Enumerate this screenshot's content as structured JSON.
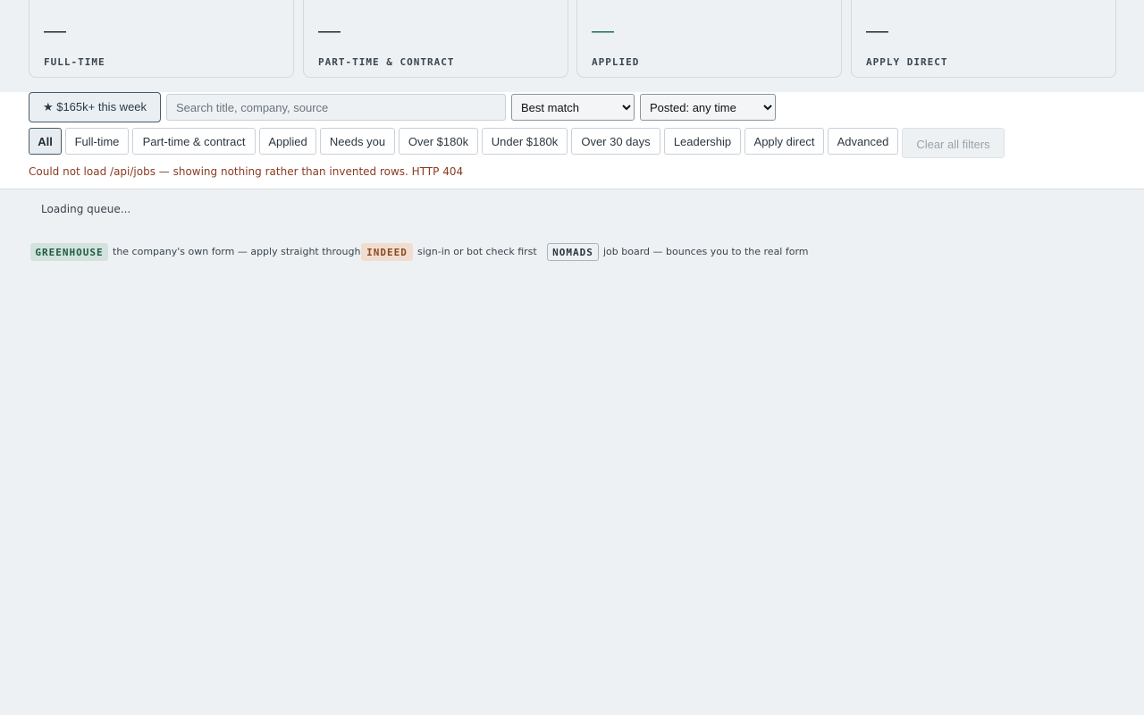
{
  "stats": [
    {
      "value": "————",
      "label": "FULL-TIME"
    },
    {
      "value": "————",
      "label": "PART-TIME & CONTRACT"
    },
    {
      "value": "————",
      "label": "APPLIED"
    },
    {
      "value": "————",
      "label": "APPLY DIRECT"
    }
  ],
  "toolbar": {
    "highlight_label": "★ $165k+ this week",
    "search_placeholder": "Search title, company, source",
    "sort_selected": "Best match",
    "posted_selected": "Posted: any time"
  },
  "chips": [
    {
      "label": "All",
      "active": true
    },
    {
      "label": "Full-time"
    },
    {
      "label": "Part-time & contract"
    },
    {
      "label": "Applied"
    },
    {
      "label": "Needs you"
    },
    {
      "label": "Over $180k"
    },
    {
      "label": "Under $180k"
    },
    {
      "label": "Over 30 days"
    },
    {
      "label": "Leadership"
    },
    {
      "label": "Apply direct"
    },
    {
      "label": "Advanced"
    }
  ],
  "clear_label": "Clear all filters",
  "error_message": "Could not load /api/jobs — showing nothing rather than invented rows. HTTP 404",
  "loading_text": "Loading queue...",
  "legend": [
    {
      "tag": "GREENHOUSE",
      "description": "the company's own form — apply straight through"
    },
    {
      "tag": "INDEED",
      "description": "sign-in or bot check first"
    },
    {
      "tag": "NOMADS",
      "description": "job board — bounces you to the real form"
    }
  ],
  "colors": {
    "background": "#edf1f4",
    "accent_green": "#1f6b4f",
    "error_text": "#8a3a22"
  }
}
